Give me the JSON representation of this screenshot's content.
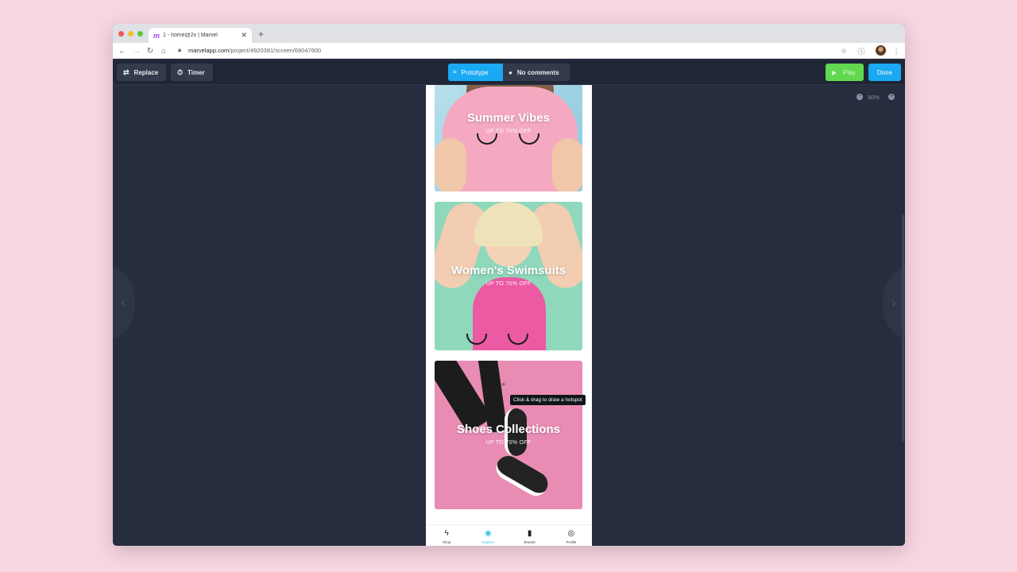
{
  "browser": {
    "tab_title": "1 - home@2x | Marvel",
    "tab_favicon": "m",
    "new_tab_symbol": "+",
    "url_host": "marvelapp.com",
    "url_path": "/project/4920381/screen/69047600"
  },
  "toolbar": {
    "replace_label": "Replace",
    "timer_label": "Timer",
    "prototype_label": "Prototype",
    "comments_label": "No comments",
    "play_label": "Play",
    "done_label": "Done"
  },
  "canvas": {
    "zoom_level": "50%"
  },
  "cards": [
    {
      "title": "Summer Vibes",
      "subtitle": "UP TO 70% OFF"
    },
    {
      "title": "Women's Swimsuits",
      "subtitle": "UP TO 70% OFF"
    },
    {
      "title": "Shoes Collections",
      "subtitle": "UP TO 70% OFF"
    }
  ],
  "bottom_nav": [
    {
      "label": "Shop",
      "icon": "bolt-icon"
    },
    {
      "label": "Explore",
      "icon": "eye-icon"
    },
    {
      "label": "Brands",
      "icon": "bookmark-icon"
    },
    {
      "label": "Profile",
      "icon": "user-circle-icon"
    }
  ],
  "tooltip": {
    "text": "Click & drag to draw a hotspot"
  },
  "colors": {
    "page_bg": "#f7d5e1",
    "canvas_bg": "#252d3e",
    "accent_blue": "#1aa9f3",
    "play_green": "#61d84f"
  }
}
